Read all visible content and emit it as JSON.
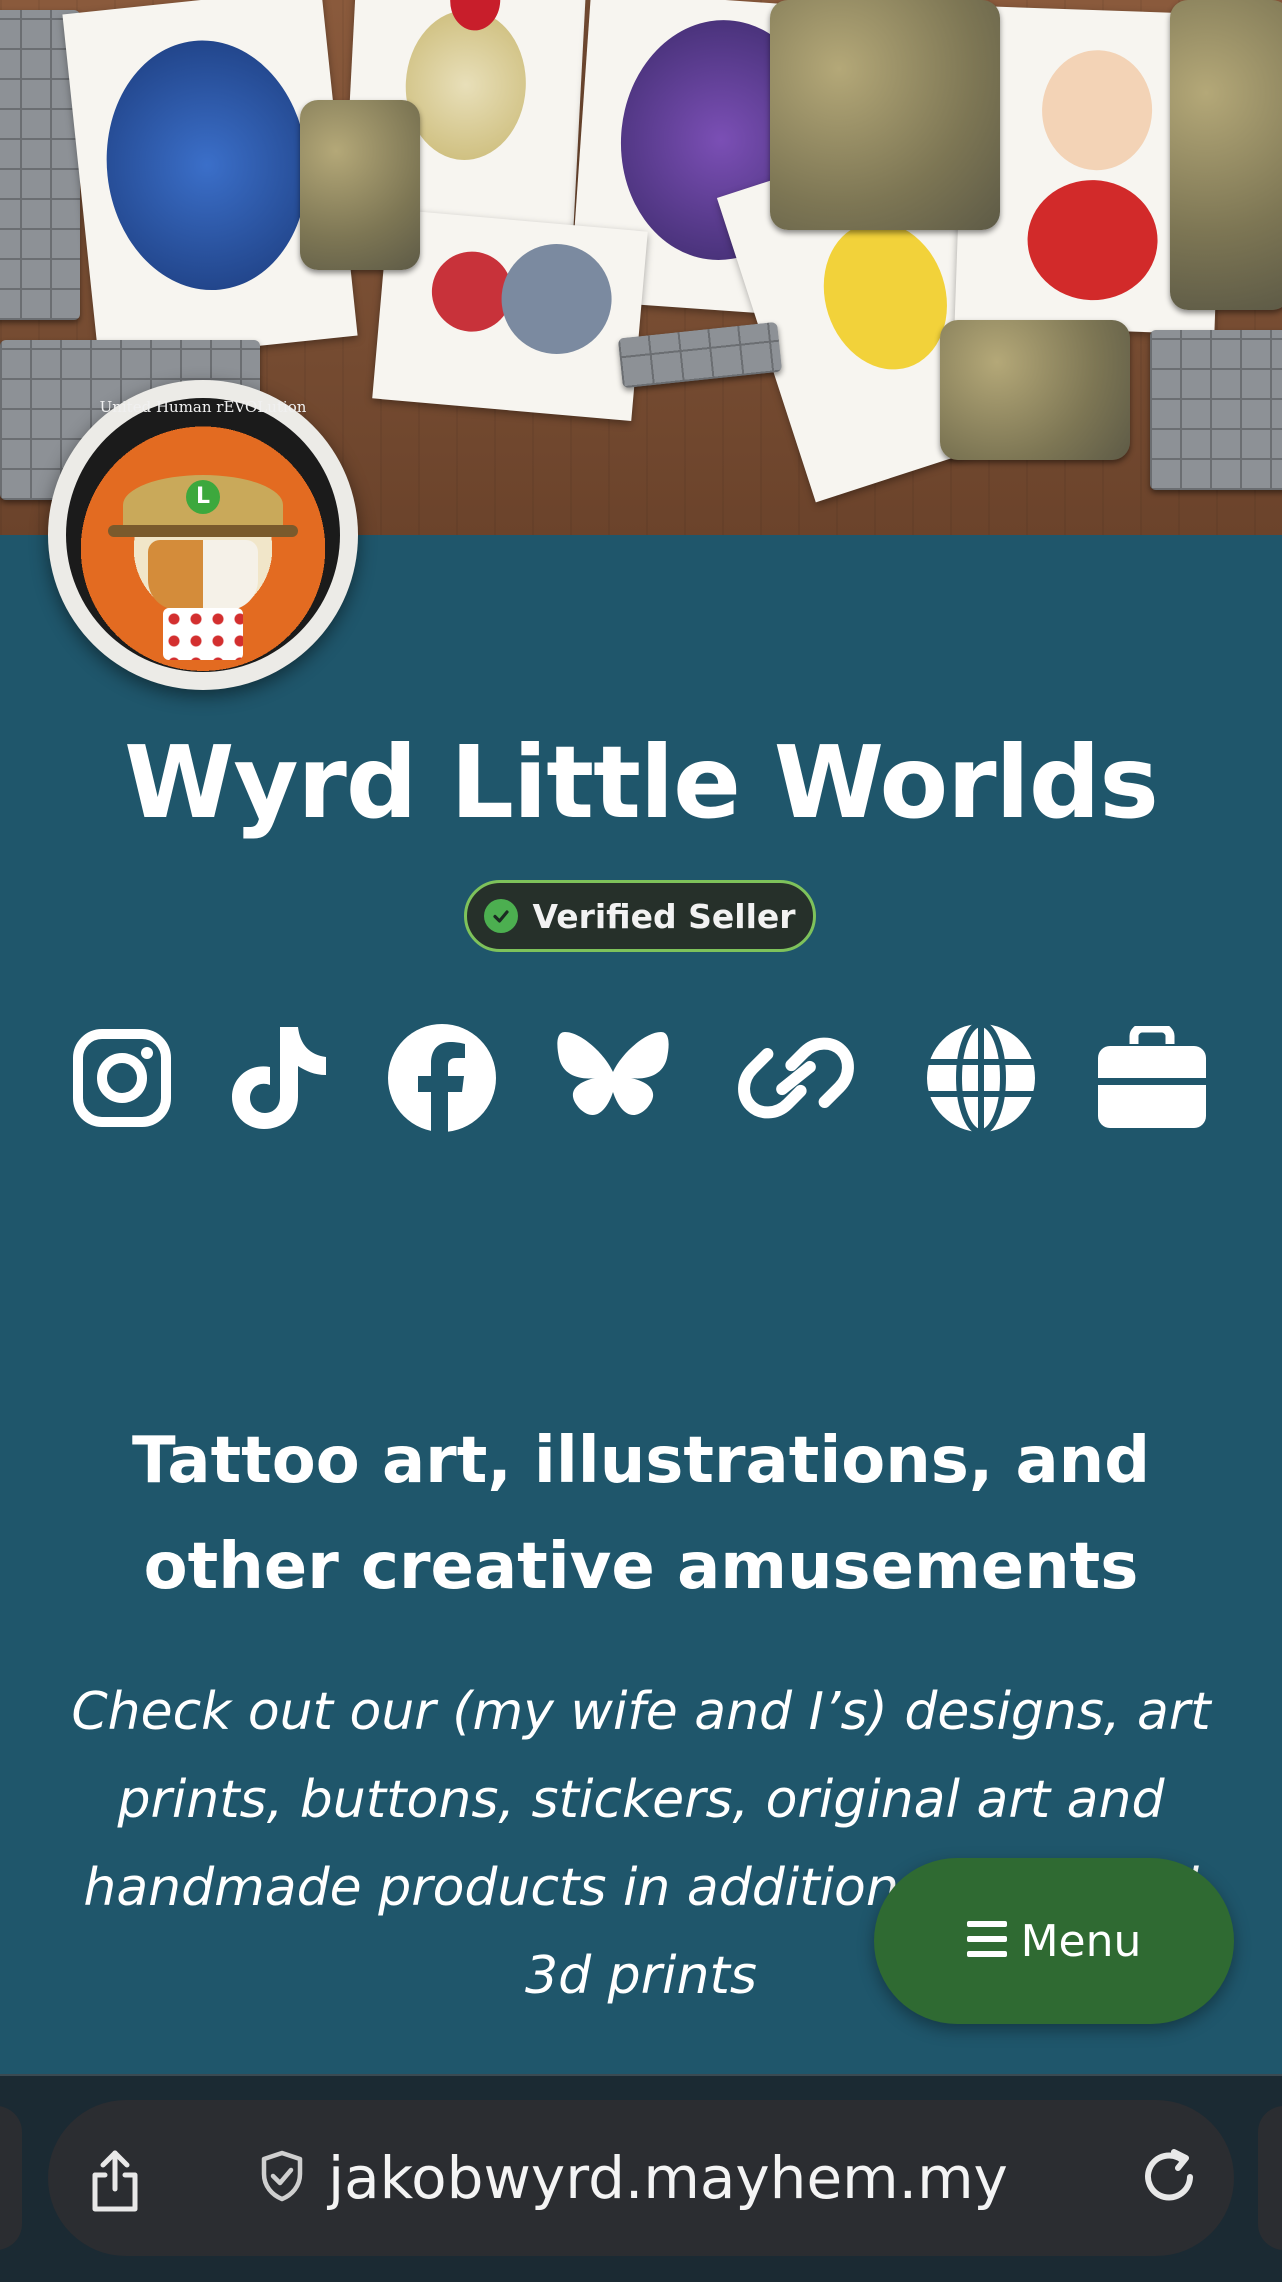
{
  "profile": {
    "name": "Wyrd Little Worlds",
    "verified_label": "Verified Seller",
    "avatar_ring_text": "United Human rEVOLution",
    "avatar_icon": "logo-badge-icon"
  },
  "social_links": [
    {
      "icon": "instagram-icon"
    },
    {
      "icon": "tiktok-icon"
    },
    {
      "icon": "facebook-icon"
    },
    {
      "icon": "bluesky-icon"
    },
    {
      "icon": "link-icon"
    },
    {
      "icon": "globe-icon"
    },
    {
      "icon": "briefcase-icon"
    }
  ],
  "content": {
    "headline": "Tattoo art, illustrations, and other creative amusements",
    "description": "Check out our (my wife and I’s) designs, art prints, buttons, stickers, original art and handmade products in addition to licensed 3d prints"
  },
  "menu_button": {
    "label": "Menu",
    "icon": "hamburger-icon"
  },
  "browser": {
    "url": "jakobwyrd.mayhem.my",
    "share_icon": "share-icon",
    "security_icon": "shield-check-icon",
    "reload_icon": "reload-icon"
  },
  "colors": {
    "page_background": "#1f566b",
    "verified_border": "#7ec25b",
    "verified_check": "#4caf50",
    "menu_button": "#2f6a32",
    "browser_bar": "#1b2a33"
  }
}
